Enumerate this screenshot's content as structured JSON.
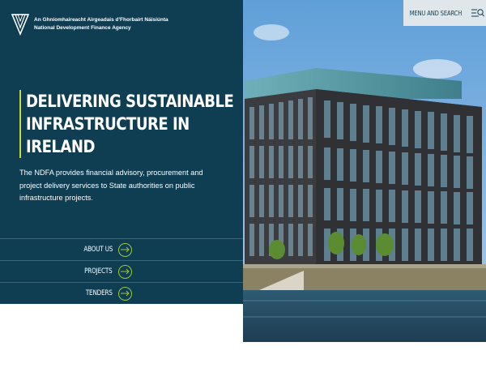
{
  "header": {
    "logo_line1": "An Ghníomhaireacht Airgeadais d'Fhorbairt Náisiúnta",
    "logo_line2": "National Development Finance Agency",
    "menu_search_label": "MENU AND SEARCH"
  },
  "hero": {
    "title_line1": "DELIVERING SUSTAINABLE",
    "title_line2": "INFRASTRUCTURE IN",
    "title_line3": "IRELAND",
    "description": "The NDFA provides financial advisory, procurement and project delivery services to State authorities on public infrastructure projects."
  },
  "nav": {
    "items": [
      {
        "label": "ABOUT US"
      },
      {
        "label": "PROJECTS"
      },
      {
        "label": "TENDERS"
      }
    ]
  },
  "colors": {
    "panel": "#0f3d52",
    "accent": "#c6d744",
    "arrow": "#9bc83c"
  }
}
